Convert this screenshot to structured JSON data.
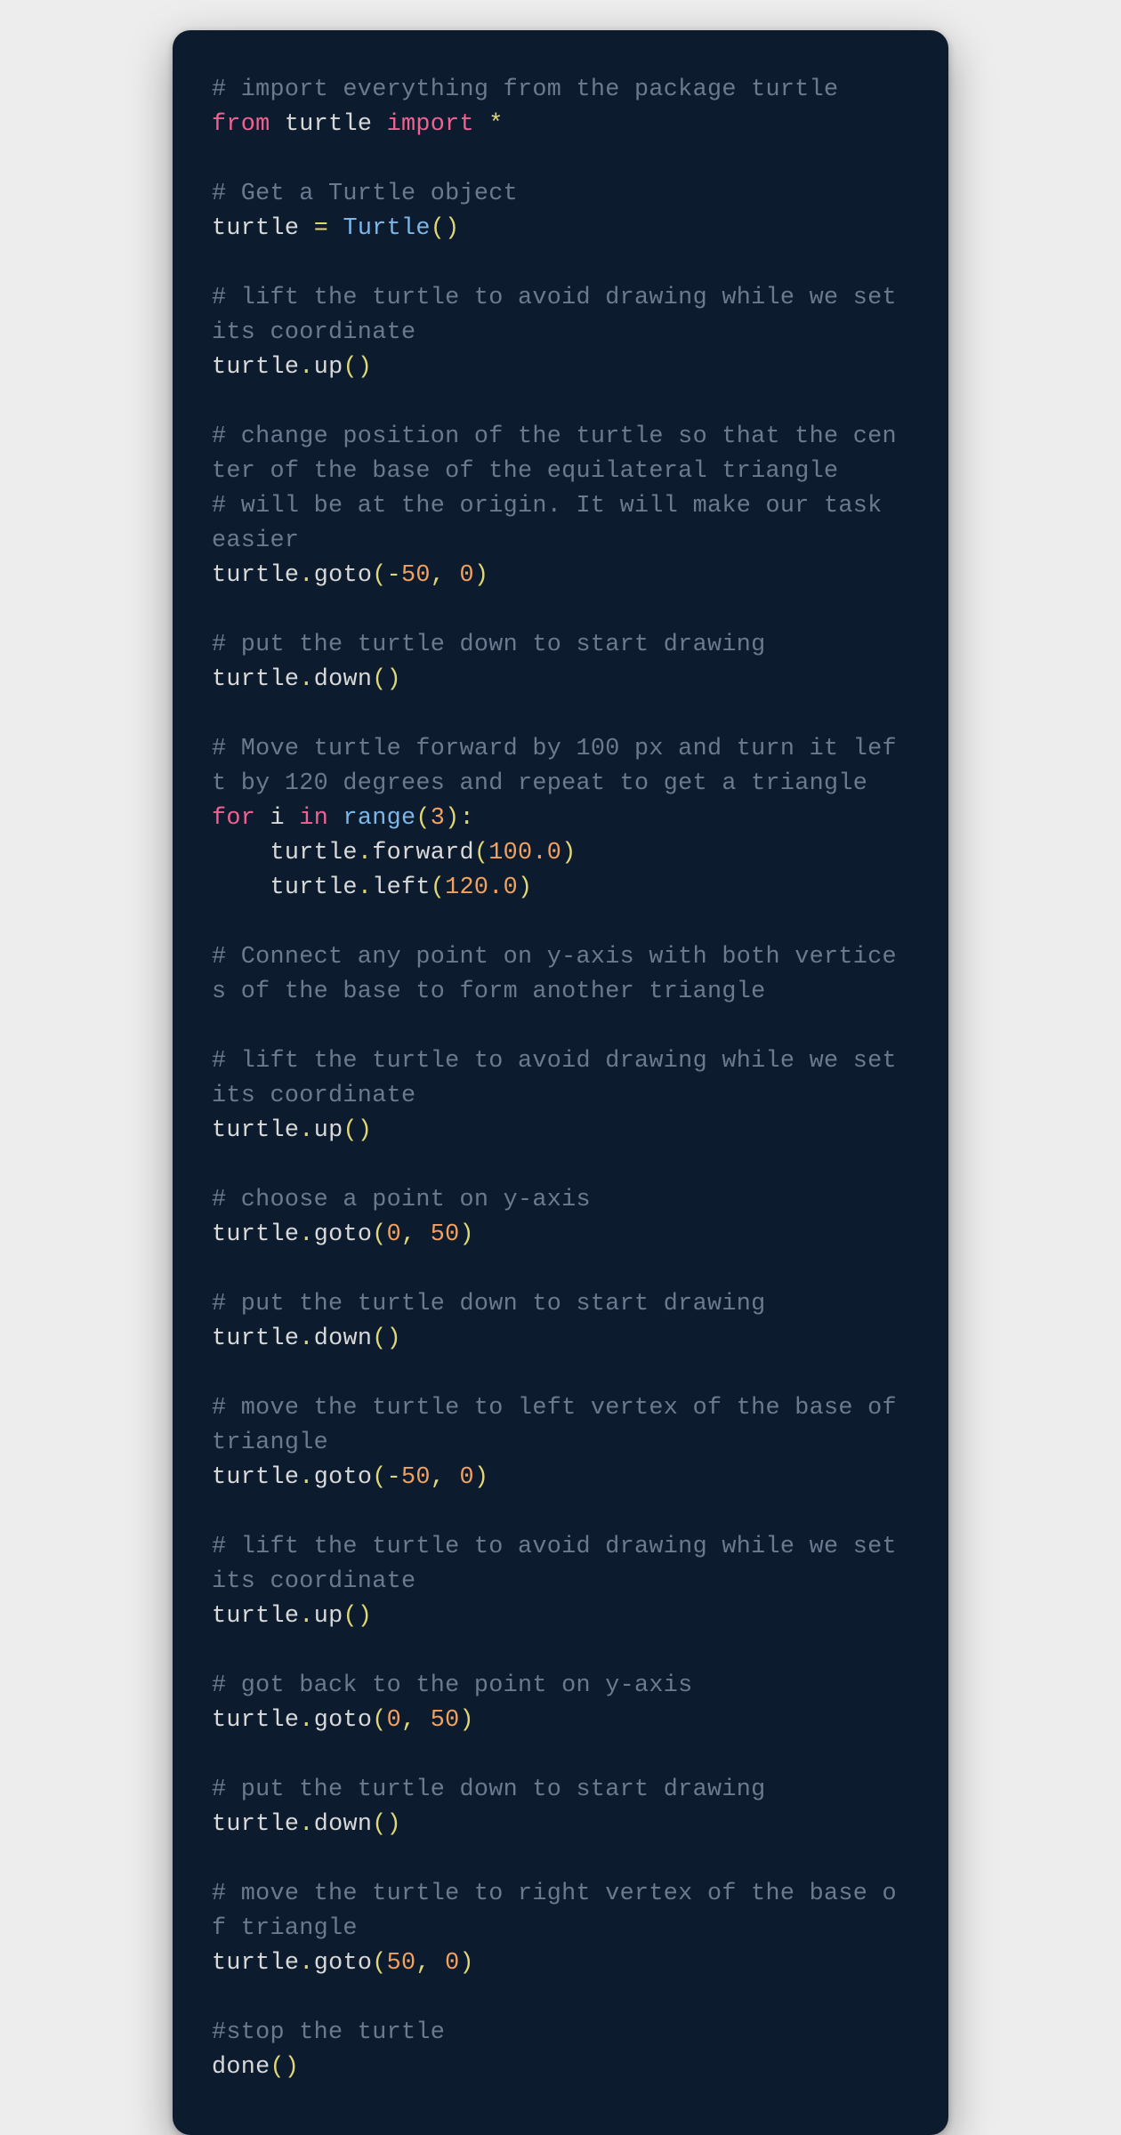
{
  "code": {
    "tokens": [
      {
        "cls": "tok-comment",
        "t": "# import everything from the package turtle"
      },
      {
        "br": 1
      },
      {
        "cls": "tok-keyword",
        "t": "from"
      },
      {
        "t": " "
      },
      {
        "cls": "tok-ident",
        "t": "turtle"
      },
      {
        "t": " "
      },
      {
        "cls": "tok-keyword",
        "t": "import"
      },
      {
        "t": " "
      },
      {
        "cls": "tok-star",
        "t": "*"
      },
      {
        "br": 1
      },
      {
        "br": 1
      },
      {
        "cls": "tok-comment",
        "t": "# Get a Turtle object"
      },
      {
        "br": 1
      },
      {
        "cls": "tok-ident",
        "t": "turtle"
      },
      {
        "t": " "
      },
      {
        "cls": "tok-op",
        "t": "="
      },
      {
        "t": " "
      },
      {
        "cls": "tok-func",
        "t": "Turtle"
      },
      {
        "cls": "tok-paren",
        "t": "("
      },
      {
        "cls": "tok-paren",
        "t": ")"
      },
      {
        "br": 1
      },
      {
        "br": 1
      },
      {
        "cls": "tok-comment",
        "t": "# lift the turtle to avoid drawing while we set its coordinate"
      },
      {
        "br": 1
      },
      {
        "cls": "tok-ident",
        "t": "turtle"
      },
      {
        "cls": "tok-op",
        "t": "."
      },
      {
        "cls": "tok-call",
        "t": "up"
      },
      {
        "cls": "tok-paren",
        "t": "("
      },
      {
        "cls": "tok-paren",
        "t": ")"
      },
      {
        "br": 1
      },
      {
        "br": 1
      },
      {
        "cls": "tok-comment",
        "t": "# change position of the turtle so that the center of the base of the equilateral triangle"
      },
      {
        "br": 1
      },
      {
        "cls": "tok-comment",
        "t": "# will be at the origin. It will make our task easier"
      },
      {
        "br": 1
      },
      {
        "cls": "tok-ident",
        "t": "turtle"
      },
      {
        "cls": "tok-op",
        "t": "."
      },
      {
        "cls": "tok-call",
        "t": "goto"
      },
      {
        "cls": "tok-paren",
        "t": "("
      },
      {
        "cls": "tok-op",
        "t": "-"
      },
      {
        "cls": "tok-num",
        "t": "50"
      },
      {
        "cls": "tok-op",
        "t": ","
      },
      {
        "t": " "
      },
      {
        "cls": "tok-num",
        "t": "0"
      },
      {
        "cls": "tok-paren",
        "t": ")"
      },
      {
        "br": 1
      },
      {
        "br": 1
      },
      {
        "cls": "tok-comment",
        "t": "# put the turtle down to start drawing"
      },
      {
        "br": 1
      },
      {
        "cls": "tok-ident",
        "t": "turtle"
      },
      {
        "cls": "tok-op",
        "t": "."
      },
      {
        "cls": "tok-call",
        "t": "down"
      },
      {
        "cls": "tok-paren",
        "t": "("
      },
      {
        "cls": "tok-paren",
        "t": ")"
      },
      {
        "br": 1
      },
      {
        "br": 1
      },
      {
        "cls": "tok-comment",
        "t": "# Move turtle forward by 100 px and turn it left by 120 degrees and repeat to get a triangle"
      },
      {
        "br": 1
      },
      {
        "cls": "tok-keyword",
        "t": "for"
      },
      {
        "t": " "
      },
      {
        "cls": "tok-ident",
        "t": "i"
      },
      {
        "t": " "
      },
      {
        "cls": "tok-keyword",
        "t": "in"
      },
      {
        "t": " "
      },
      {
        "cls": "tok-func",
        "t": "range"
      },
      {
        "cls": "tok-paren",
        "t": "("
      },
      {
        "cls": "tok-num",
        "t": "3"
      },
      {
        "cls": "tok-paren",
        "t": ")"
      },
      {
        "cls": "tok-op",
        "t": ":"
      },
      {
        "br": 1
      },
      {
        "t": "    "
      },
      {
        "cls": "tok-ident",
        "t": "turtle"
      },
      {
        "cls": "tok-op",
        "t": "."
      },
      {
        "cls": "tok-call",
        "t": "forward"
      },
      {
        "cls": "tok-paren",
        "t": "("
      },
      {
        "cls": "tok-num",
        "t": "100.0"
      },
      {
        "cls": "tok-paren",
        "t": ")"
      },
      {
        "br": 1
      },
      {
        "t": "    "
      },
      {
        "cls": "tok-ident",
        "t": "turtle"
      },
      {
        "cls": "tok-op",
        "t": "."
      },
      {
        "cls": "tok-call",
        "t": "left"
      },
      {
        "cls": "tok-paren",
        "t": "("
      },
      {
        "cls": "tok-num",
        "t": "120.0"
      },
      {
        "cls": "tok-paren",
        "t": ")"
      },
      {
        "br": 1
      },
      {
        "br": 1
      },
      {
        "cls": "tok-comment",
        "t": "# Connect any point on y-axis with both vertices of the base to form another triangle"
      },
      {
        "br": 1
      },
      {
        "br": 1
      },
      {
        "cls": "tok-comment",
        "t": "# lift the turtle to avoid drawing while we set its coordinate"
      },
      {
        "br": 1
      },
      {
        "cls": "tok-ident",
        "t": "turtle"
      },
      {
        "cls": "tok-op",
        "t": "."
      },
      {
        "cls": "tok-call",
        "t": "up"
      },
      {
        "cls": "tok-paren",
        "t": "("
      },
      {
        "cls": "tok-paren",
        "t": ")"
      },
      {
        "br": 1
      },
      {
        "br": 1
      },
      {
        "cls": "tok-comment",
        "t": "# choose a point on y-axis"
      },
      {
        "br": 1
      },
      {
        "cls": "tok-ident",
        "t": "turtle"
      },
      {
        "cls": "tok-op",
        "t": "."
      },
      {
        "cls": "tok-call",
        "t": "goto"
      },
      {
        "cls": "tok-paren",
        "t": "("
      },
      {
        "cls": "tok-num",
        "t": "0"
      },
      {
        "cls": "tok-op",
        "t": ","
      },
      {
        "t": " "
      },
      {
        "cls": "tok-num",
        "t": "50"
      },
      {
        "cls": "tok-paren",
        "t": ")"
      },
      {
        "br": 1
      },
      {
        "br": 1
      },
      {
        "cls": "tok-comment",
        "t": "# put the turtle down to start drawing"
      },
      {
        "br": 1
      },
      {
        "cls": "tok-ident",
        "t": "turtle"
      },
      {
        "cls": "tok-op",
        "t": "."
      },
      {
        "cls": "tok-call",
        "t": "down"
      },
      {
        "cls": "tok-paren",
        "t": "("
      },
      {
        "cls": "tok-paren",
        "t": ")"
      },
      {
        "br": 1
      },
      {
        "br": 1
      },
      {
        "cls": "tok-comment",
        "t": "# move the turtle to left vertex of the base of triangle"
      },
      {
        "br": 1
      },
      {
        "cls": "tok-ident",
        "t": "turtle"
      },
      {
        "cls": "tok-op",
        "t": "."
      },
      {
        "cls": "tok-call",
        "t": "goto"
      },
      {
        "cls": "tok-paren",
        "t": "("
      },
      {
        "cls": "tok-op",
        "t": "-"
      },
      {
        "cls": "tok-num",
        "t": "50"
      },
      {
        "cls": "tok-op",
        "t": ","
      },
      {
        "t": " "
      },
      {
        "cls": "tok-num",
        "t": "0"
      },
      {
        "cls": "tok-paren",
        "t": ")"
      },
      {
        "br": 1
      },
      {
        "br": 1
      },
      {
        "cls": "tok-comment",
        "t": "# lift the turtle to avoid drawing while we set its coordinate"
      },
      {
        "br": 1
      },
      {
        "cls": "tok-ident",
        "t": "turtle"
      },
      {
        "cls": "tok-op",
        "t": "."
      },
      {
        "cls": "tok-call",
        "t": "up"
      },
      {
        "cls": "tok-paren",
        "t": "("
      },
      {
        "cls": "tok-paren",
        "t": ")"
      },
      {
        "br": 1
      },
      {
        "br": 1
      },
      {
        "cls": "tok-comment",
        "t": "# got back to the point on y-axis"
      },
      {
        "br": 1
      },
      {
        "cls": "tok-ident",
        "t": "turtle"
      },
      {
        "cls": "tok-op",
        "t": "."
      },
      {
        "cls": "tok-call",
        "t": "goto"
      },
      {
        "cls": "tok-paren",
        "t": "("
      },
      {
        "cls": "tok-num",
        "t": "0"
      },
      {
        "cls": "tok-op",
        "t": ","
      },
      {
        "t": " "
      },
      {
        "cls": "tok-num",
        "t": "50"
      },
      {
        "cls": "tok-paren",
        "t": ")"
      },
      {
        "br": 1
      },
      {
        "br": 1
      },
      {
        "cls": "tok-comment",
        "t": "# put the turtle down to start drawing"
      },
      {
        "br": 1
      },
      {
        "cls": "tok-ident",
        "t": "turtle"
      },
      {
        "cls": "tok-op",
        "t": "."
      },
      {
        "cls": "tok-call",
        "t": "down"
      },
      {
        "cls": "tok-paren",
        "t": "("
      },
      {
        "cls": "tok-paren",
        "t": ")"
      },
      {
        "br": 1
      },
      {
        "br": 1
      },
      {
        "cls": "tok-comment",
        "t": "# move the turtle to right vertex of the base of triangle"
      },
      {
        "br": 1
      },
      {
        "cls": "tok-ident",
        "t": "turtle"
      },
      {
        "cls": "tok-op",
        "t": "."
      },
      {
        "cls": "tok-call",
        "t": "goto"
      },
      {
        "cls": "tok-paren",
        "t": "("
      },
      {
        "cls": "tok-num",
        "t": "50"
      },
      {
        "cls": "tok-op",
        "t": ","
      },
      {
        "t": " "
      },
      {
        "cls": "tok-num",
        "t": "0"
      },
      {
        "cls": "tok-paren",
        "t": ")"
      },
      {
        "br": 1
      },
      {
        "br": 1
      },
      {
        "cls": "tok-comment",
        "t": "#stop the turtle"
      },
      {
        "br": 1
      },
      {
        "cls": "tok-call",
        "t": "done"
      },
      {
        "cls": "tok-paren",
        "t": "("
      },
      {
        "cls": "tok-paren",
        "t": ")"
      }
    ]
  }
}
